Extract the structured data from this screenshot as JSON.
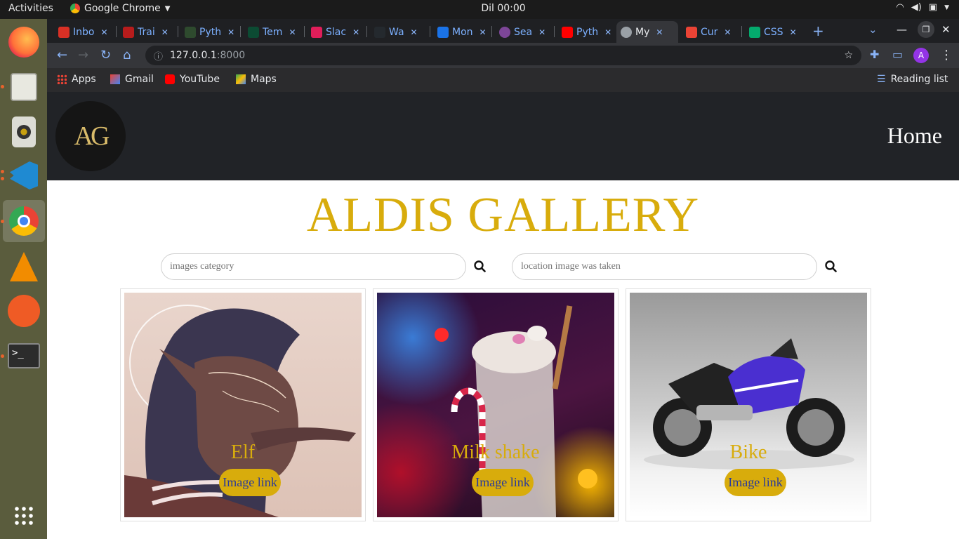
{
  "desktop": {
    "activities": "Activities",
    "app_name": "Google Chrome",
    "clock": "Dil 00:00",
    "dock_items": [
      "firefox-icon",
      "files-icon",
      "speaker-icon",
      "vscode-icon",
      "chrome-icon",
      "vlc-icon",
      "postman-icon",
      "terminal-icon",
      "app-grid-icon"
    ]
  },
  "browser": {
    "tabs": [
      {
        "label": "Inbo",
        "icon": "gmail-icon",
        "color": "#d93025"
      },
      {
        "label": "Trai",
        "icon": "scroll-icon",
        "color": "#b71c1c"
      },
      {
        "label": "Pyth",
        "icon": "tree-icon",
        "color": "#2e4a2e"
      },
      {
        "label": "Tem",
        "icon": "django-icon",
        "color": "#0c4b33"
      },
      {
        "label": "Slac",
        "icon": "slack-icon",
        "color": "#e01e5a"
      },
      {
        "label": "Wa",
        "icon": "github-icon",
        "color": "#24292e"
      },
      {
        "label": "Mon",
        "icon": "calendar-icon",
        "color": "#1a73e8"
      },
      {
        "label": "Sea",
        "icon": "tor-icon",
        "color": "#7d4698"
      },
      {
        "label": "Pyth",
        "icon": "youtube-icon",
        "color": "#ff0000"
      },
      {
        "label": "My",
        "icon": "globe-icon",
        "color": "#9aa0a6"
      },
      {
        "label": "Cur",
        "icon": "asterisk-icon",
        "color": "#ea4335"
      },
      {
        "label": "CSS",
        "icon": "w3-icon",
        "color": "#04aa6d"
      }
    ],
    "url_host": "127.0.0.1",
    "url_port": ":8000",
    "profile_initial": "A",
    "bookmarks": [
      {
        "label": "Apps",
        "icon": "apps-grid-icon"
      },
      {
        "label": "Gmail",
        "icon": "gmail-icon"
      },
      {
        "label": "YouTube",
        "icon": "youtube-icon"
      },
      {
        "label": "Maps",
        "icon": "maps-icon"
      }
    ],
    "reading_list": "Reading list"
  },
  "page": {
    "logo_text": "AG",
    "nav_home": "Home",
    "title": "ALDIS GALLERY",
    "search_category_placeholder": "images category",
    "search_location_placeholder": "location image was taken",
    "cards": [
      {
        "caption": "Elf",
        "link_label": "Image link"
      },
      {
        "caption": "Milk shake",
        "link_label": "Image link"
      },
      {
        "caption": "Bike",
        "link_label": "Image link"
      }
    ]
  },
  "colors": {
    "accent_gold": "#d8ac0c",
    "link_text_blue": "#2a3a9a",
    "navbar_dark": "#212327"
  }
}
